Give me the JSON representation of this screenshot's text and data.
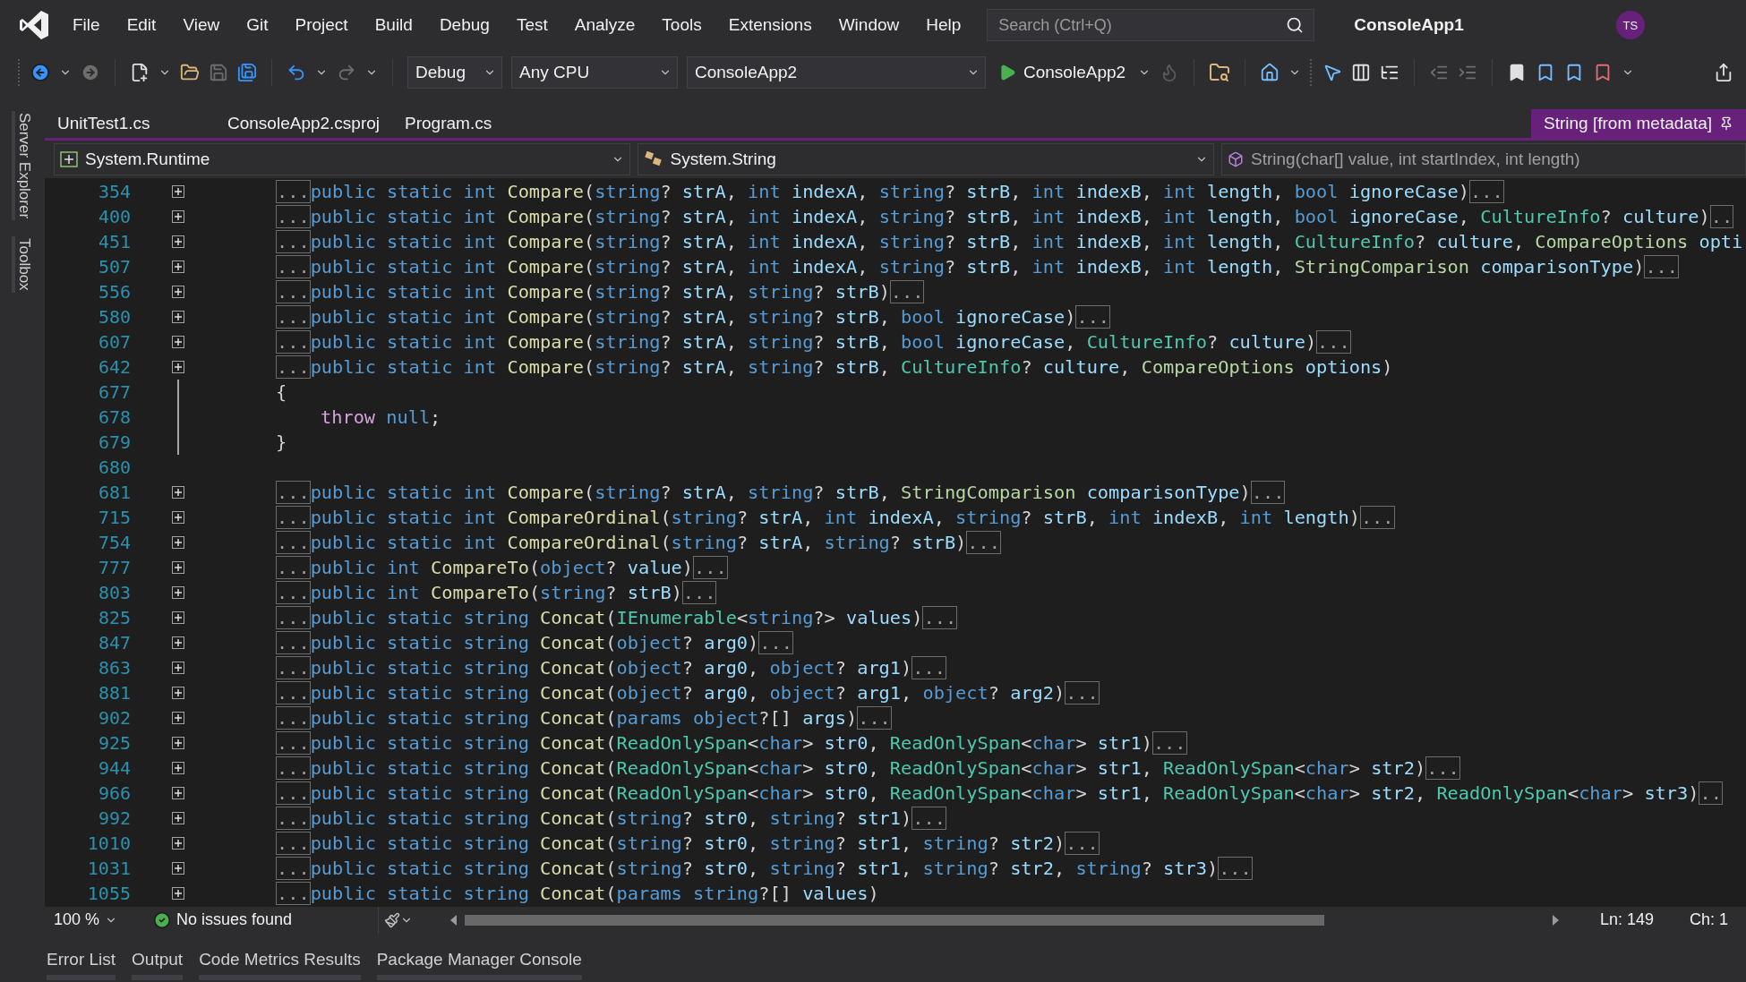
{
  "menu": [
    "File",
    "Edit",
    "View",
    "Git",
    "Project",
    "Build",
    "Debug",
    "Test",
    "Analyze",
    "Tools",
    "Extensions",
    "Window",
    "Help"
  ],
  "search": {
    "placeholder": "Search (Ctrl+Q)"
  },
  "solution_title": "ConsoleApp1",
  "account": {
    "initials": "TS"
  },
  "toolbar": {
    "configuration": "Debug",
    "platform": "Any CPU",
    "startup_project": "ConsoleApp2",
    "run_label": "ConsoleApp2"
  },
  "side_tabs": [
    "Server Explorer",
    "Toolbox"
  ],
  "document_tabs": [
    {
      "label": "UnitTest1.cs",
      "selected": false
    },
    {
      "label": "ConsoleApp2.csproj",
      "selected": false
    },
    {
      "label": "Program.cs",
      "selected": false
    },
    {
      "label": "String [from metadata]",
      "selected": true
    }
  ],
  "navigation": {
    "project": "System.Runtime",
    "type": "System.String",
    "member": "String(char[] value, int startIndex, int length)"
  },
  "code_lines": [
    {
      "number": "354",
      "kind": "collapsed",
      "tokens": [
        {
          "kind": "fold",
          "text": "..."
        },
        {
          "kind": "keyword",
          "text": "public static int "
        },
        {
          "kind": "method",
          "text": "Compare"
        },
        {
          "kind": "punct",
          "text": "("
        },
        {
          "kind": "keyword",
          "text": "string"
        },
        {
          "kind": "punct",
          "text": "? "
        },
        {
          "kind": "param",
          "text": "strA"
        },
        {
          "kind": "punct",
          "text": ", "
        },
        {
          "kind": "keyword",
          "text": "int "
        },
        {
          "kind": "param",
          "text": "indexA"
        },
        {
          "kind": "punct",
          "text": ", "
        },
        {
          "kind": "keyword",
          "text": "string"
        },
        {
          "kind": "punct",
          "text": "? "
        },
        {
          "kind": "param",
          "text": "strB"
        },
        {
          "kind": "punct",
          "text": ", "
        },
        {
          "kind": "keyword",
          "text": "int "
        },
        {
          "kind": "param",
          "text": "indexB"
        },
        {
          "kind": "punct",
          "text": ", "
        },
        {
          "kind": "keyword",
          "text": "int "
        },
        {
          "kind": "param",
          "text": "length"
        },
        {
          "kind": "punct",
          "text": ", "
        },
        {
          "kind": "keyword",
          "text": "bool "
        },
        {
          "kind": "param",
          "text": "ignoreCase"
        },
        {
          "kind": "punct",
          "text": ")"
        },
        {
          "kind": "fold",
          "text": "..."
        }
      ]
    },
    {
      "number": "400",
      "kind": "collapsed",
      "tokens": [
        {
          "kind": "fold",
          "text": "..."
        },
        {
          "kind": "keyword",
          "text": "public static int "
        },
        {
          "kind": "method",
          "text": "Compare"
        },
        {
          "kind": "punct",
          "text": "("
        },
        {
          "kind": "keyword",
          "text": "string"
        },
        {
          "kind": "punct",
          "text": "? "
        },
        {
          "kind": "param",
          "text": "strA"
        },
        {
          "kind": "punct",
          "text": ", "
        },
        {
          "kind": "keyword",
          "text": "int "
        },
        {
          "kind": "param",
          "text": "indexA"
        },
        {
          "kind": "punct",
          "text": ", "
        },
        {
          "kind": "keyword",
          "text": "string"
        },
        {
          "kind": "punct",
          "text": "? "
        },
        {
          "kind": "param",
          "text": "strB"
        },
        {
          "kind": "punct",
          "text": ", "
        },
        {
          "kind": "keyword",
          "text": "int "
        },
        {
          "kind": "param",
          "text": "indexB"
        },
        {
          "kind": "punct",
          "text": ", "
        },
        {
          "kind": "keyword",
          "text": "int "
        },
        {
          "kind": "param",
          "text": "length"
        },
        {
          "kind": "punct",
          "text": ", "
        },
        {
          "kind": "keyword",
          "text": "bool "
        },
        {
          "kind": "param",
          "text": "ignoreCase"
        },
        {
          "kind": "punct",
          "text": ", "
        },
        {
          "kind": "type",
          "text": "CultureInfo"
        },
        {
          "kind": "punct",
          "text": "? "
        },
        {
          "kind": "param",
          "text": "culture"
        },
        {
          "kind": "punct",
          "text": ")"
        },
        {
          "kind": "fold",
          "text": ".."
        }
      ]
    },
    {
      "number": "451",
      "kind": "collapsed",
      "tokens": [
        {
          "kind": "fold",
          "text": "..."
        },
        {
          "kind": "keyword",
          "text": "public static int "
        },
        {
          "kind": "method",
          "text": "Compare"
        },
        {
          "kind": "punct",
          "text": "("
        },
        {
          "kind": "keyword",
          "text": "string"
        },
        {
          "kind": "punct",
          "text": "? "
        },
        {
          "kind": "param",
          "text": "strA"
        },
        {
          "kind": "punct",
          "text": ", "
        },
        {
          "kind": "keyword",
          "text": "int "
        },
        {
          "kind": "param",
          "text": "indexA"
        },
        {
          "kind": "punct",
          "text": ", "
        },
        {
          "kind": "keyword",
          "text": "string"
        },
        {
          "kind": "punct",
          "text": "? "
        },
        {
          "kind": "param",
          "text": "strB"
        },
        {
          "kind": "punct",
          "text": ", "
        },
        {
          "kind": "keyword",
          "text": "int "
        },
        {
          "kind": "param",
          "text": "indexB"
        },
        {
          "kind": "punct",
          "text": ", "
        },
        {
          "kind": "keyword",
          "text": "int "
        },
        {
          "kind": "param",
          "text": "length"
        },
        {
          "kind": "punct",
          "text": ", "
        },
        {
          "kind": "type",
          "text": "CultureInfo"
        },
        {
          "kind": "punct",
          "text": "? "
        },
        {
          "kind": "param",
          "text": "culture"
        },
        {
          "kind": "punct",
          "text": ", "
        },
        {
          "kind": "enum",
          "text": "CompareOptions "
        },
        {
          "kind": "param",
          "text": "opti"
        }
      ]
    },
    {
      "number": "507",
      "kind": "collapsed",
      "tokens": [
        {
          "kind": "fold",
          "text": "..."
        },
        {
          "kind": "keyword",
          "text": "public static int "
        },
        {
          "kind": "method",
          "text": "Compare"
        },
        {
          "kind": "punct",
          "text": "("
        },
        {
          "kind": "keyword",
          "text": "string"
        },
        {
          "kind": "punct",
          "text": "? "
        },
        {
          "kind": "param",
          "text": "strA"
        },
        {
          "kind": "punct",
          "text": ", "
        },
        {
          "kind": "keyword",
          "text": "int "
        },
        {
          "kind": "param",
          "text": "indexA"
        },
        {
          "kind": "punct",
          "text": ", "
        },
        {
          "kind": "keyword",
          "text": "string"
        },
        {
          "kind": "punct",
          "text": "? "
        },
        {
          "kind": "param",
          "text": "strB"
        },
        {
          "kind": "punct",
          "text": ", "
        },
        {
          "kind": "keyword",
          "text": "int "
        },
        {
          "kind": "param",
          "text": "indexB"
        },
        {
          "kind": "punct",
          "text": ", "
        },
        {
          "kind": "keyword",
          "text": "int "
        },
        {
          "kind": "param",
          "text": "length"
        },
        {
          "kind": "punct",
          "text": ", "
        },
        {
          "kind": "enum",
          "text": "StringComparison "
        },
        {
          "kind": "param",
          "text": "comparisonType"
        },
        {
          "kind": "punct",
          "text": ")"
        },
        {
          "kind": "fold",
          "text": "..."
        }
      ]
    },
    {
      "number": "556",
      "kind": "collapsed",
      "tokens": [
        {
          "kind": "fold",
          "text": "..."
        },
        {
          "kind": "keyword",
          "text": "public static int "
        },
        {
          "kind": "method",
          "text": "Compare"
        },
        {
          "kind": "punct",
          "text": "("
        },
        {
          "kind": "keyword",
          "text": "string"
        },
        {
          "kind": "punct",
          "text": "? "
        },
        {
          "kind": "param",
          "text": "strA"
        },
        {
          "kind": "punct",
          "text": ", "
        },
        {
          "kind": "keyword",
          "text": "string"
        },
        {
          "kind": "punct",
          "text": "? "
        },
        {
          "kind": "param",
          "text": "strB"
        },
        {
          "kind": "punct",
          "text": ")"
        },
        {
          "kind": "fold",
          "text": "..."
        }
      ]
    },
    {
      "number": "580",
      "kind": "collapsed",
      "tokens": [
        {
          "kind": "fold",
          "text": "..."
        },
        {
          "kind": "keyword",
          "text": "public static int "
        },
        {
          "kind": "method",
          "text": "Compare"
        },
        {
          "kind": "punct",
          "text": "("
        },
        {
          "kind": "keyword",
          "text": "string"
        },
        {
          "kind": "punct",
          "text": "? "
        },
        {
          "kind": "param",
          "text": "strA"
        },
        {
          "kind": "punct",
          "text": ", "
        },
        {
          "kind": "keyword",
          "text": "string"
        },
        {
          "kind": "punct",
          "text": "? "
        },
        {
          "kind": "param",
          "text": "strB"
        },
        {
          "kind": "punct",
          "text": ", "
        },
        {
          "kind": "keyword",
          "text": "bool "
        },
        {
          "kind": "param",
          "text": "ignoreCase"
        },
        {
          "kind": "punct",
          "text": ")"
        },
        {
          "kind": "fold",
          "text": "..."
        }
      ]
    },
    {
      "number": "607",
      "kind": "collapsed",
      "tokens": [
        {
          "kind": "fold",
          "text": "..."
        },
        {
          "kind": "keyword",
          "text": "public static int "
        },
        {
          "kind": "method",
          "text": "Compare"
        },
        {
          "kind": "punct",
          "text": "("
        },
        {
          "kind": "keyword",
          "text": "string"
        },
        {
          "kind": "punct",
          "text": "? "
        },
        {
          "kind": "param",
          "text": "strA"
        },
        {
          "kind": "punct",
          "text": ", "
        },
        {
          "kind": "keyword",
          "text": "string"
        },
        {
          "kind": "punct",
          "text": "? "
        },
        {
          "kind": "param",
          "text": "strB"
        },
        {
          "kind": "punct",
          "text": ", "
        },
        {
          "kind": "keyword",
          "text": "bool "
        },
        {
          "kind": "param",
          "text": "ignoreCase"
        },
        {
          "kind": "punct",
          "text": ", "
        },
        {
          "kind": "type",
          "text": "CultureInfo"
        },
        {
          "kind": "punct",
          "text": "? "
        },
        {
          "kind": "param",
          "text": "culture"
        },
        {
          "kind": "punct",
          "text": ")"
        },
        {
          "kind": "fold",
          "text": "..."
        }
      ]
    },
    {
      "number": "642",
      "kind": "collapsed",
      "tokens": [
        {
          "kind": "fold",
          "text": "..."
        },
        {
          "kind": "keyword",
          "text": "public static int "
        },
        {
          "kind": "method",
          "text": "Compare"
        },
        {
          "kind": "punct",
          "text": "("
        },
        {
          "kind": "keyword",
          "text": "string"
        },
        {
          "kind": "punct",
          "text": "? "
        },
        {
          "kind": "param",
          "text": "strA"
        },
        {
          "kind": "punct",
          "text": ", "
        },
        {
          "kind": "keyword",
          "text": "string"
        },
        {
          "kind": "punct",
          "text": "? "
        },
        {
          "kind": "param",
          "text": "strB"
        },
        {
          "kind": "punct",
          "text": ", "
        },
        {
          "kind": "type",
          "text": "CultureInfo"
        },
        {
          "kind": "punct",
          "text": "? "
        },
        {
          "kind": "param",
          "text": "culture"
        },
        {
          "kind": "punct",
          "text": ", "
        },
        {
          "kind": "enum",
          "text": "CompareOptions "
        },
        {
          "kind": "param",
          "text": "options"
        },
        {
          "kind": "punct",
          "text": ")"
        }
      ]
    },
    {
      "number": "677",
      "kind": "block",
      "tokens": [
        {
          "kind": "punct",
          "text": "{"
        }
      ]
    },
    {
      "number": "678",
      "kind": "body",
      "tokens": [
        {
          "kind": "control",
          "text": "throw "
        },
        {
          "kind": "keyword",
          "text": "null"
        },
        {
          "kind": "punct",
          "text": ";"
        }
      ]
    },
    {
      "number": "679",
      "kind": "block",
      "tokens": [
        {
          "kind": "punct",
          "text": "}"
        }
      ]
    },
    {
      "number": "680",
      "kind": "blank"
    },
    {
      "number": "681",
      "kind": "collapsed",
      "tokens": [
        {
          "kind": "fold",
          "text": "..."
        },
        {
          "kind": "keyword",
          "text": "public static int "
        },
        {
          "kind": "method",
          "text": "Compare"
        },
        {
          "kind": "punct",
          "text": "("
        },
        {
          "kind": "keyword",
          "text": "string"
        },
        {
          "kind": "punct",
          "text": "? "
        },
        {
          "kind": "param",
          "text": "strA"
        },
        {
          "kind": "punct",
          "text": ", "
        },
        {
          "kind": "keyword",
          "text": "string"
        },
        {
          "kind": "punct",
          "text": "? "
        },
        {
          "kind": "param",
          "text": "strB"
        },
        {
          "kind": "punct",
          "text": ", "
        },
        {
          "kind": "enum",
          "text": "StringComparison "
        },
        {
          "kind": "param",
          "text": "comparisonType"
        },
        {
          "kind": "punct",
          "text": ")"
        },
        {
          "kind": "fold",
          "text": "..."
        }
      ]
    },
    {
      "number": "715",
      "kind": "collapsed",
      "tokens": [
        {
          "kind": "fold",
          "text": "..."
        },
        {
          "kind": "keyword",
          "text": "public static int "
        },
        {
          "kind": "method",
          "text": "CompareOrdinal"
        },
        {
          "kind": "punct",
          "text": "("
        },
        {
          "kind": "keyword",
          "text": "string"
        },
        {
          "kind": "punct",
          "text": "? "
        },
        {
          "kind": "param",
          "text": "strA"
        },
        {
          "kind": "punct",
          "text": ", "
        },
        {
          "kind": "keyword",
          "text": "int "
        },
        {
          "kind": "param",
          "text": "indexA"
        },
        {
          "kind": "punct",
          "text": ", "
        },
        {
          "kind": "keyword",
          "text": "string"
        },
        {
          "kind": "punct",
          "text": "? "
        },
        {
          "kind": "param",
          "text": "strB"
        },
        {
          "kind": "punct",
          "text": ", "
        },
        {
          "kind": "keyword",
          "text": "int "
        },
        {
          "kind": "param",
          "text": "indexB"
        },
        {
          "kind": "punct",
          "text": ", "
        },
        {
          "kind": "keyword",
          "text": "int "
        },
        {
          "kind": "param",
          "text": "length"
        },
        {
          "kind": "punct",
          "text": ")"
        },
        {
          "kind": "fold",
          "text": "..."
        }
      ]
    },
    {
      "number": "754",
      "kind": "collapsed",
      "tokens": [
        {
          "kind": "fold",
          "text": "..."
        },
        {
          "kind": "keyword",
          "text": "public static int "
        },
        {
          "kind": "method",
          "text": "CompareOrdinal"
        },
        {
          "kind": "punct",
          "text": "("
        },
        {
          "kind": "keyword",
          "text": "string"
        },
        {
          "kind": "punct",
          "text": "? "
        },
        {
          "kind": "param",
          "text": "strA"
        },
        {
          "kind": "punct",
          "text": ", "
        },
        {
          "kind": "keyword",
          "text": "string"
        },
        {
          "kind": "punct",
          "text": "? "
        },
        {
          "kind": "param",
          "text": "strB"
        },
        {
          "kind": "punct",
          "text": ")"
        },
        {
          "kind": "fold",
          "text": "..."
        }
      ]
    },
    {
      "number": "777",
      "kind": "collapsed",
      "tokens": [
        {
          "kind": "fold",
          "text": "..."
        },
        {
          "kind": "keyword",
          "text": "public int "
        },
        {
          "kind": "method",
          "text": "CompareTo"
        },
        {
          "kind": "punct",
          "text": "("
        },
        {
          "kind": "keyword",
          "text": "object"
        },
        {
          "kind": "punct",
          "text": "? "
        },
        {
          "kind": "param",
          "text": "value"
        },
        {
          "kind": "punct",
          "text": ")"
        },
        {
          "kind": "fold",
          "text": "..."
        }
      ]
    },
    {
      "number": "803",
      "kind": "collapsed",
      "tokens": [
        {
          "kind": "fold",
          "text": "..."
        },
        {
          "kind": "keyword",
          "text": "public int "
        },
        {
          "kind": "method",
          "text": "CompareTo"
        },
        {
          "kind": "punct",
          "text": "("
        },
        {
          "kind": "keyword",
          "text": "string"
        },
        {
          "kind": "punct",
          "text": "? "
        },
        {
          "kind": "param",
          "text": "strB"
        },
        {
          "kind": "punct",
          "text": ")"
        },
        {
          "kind": "fold",
          "text": "..."
        }
      ]
    },
    {
      "number": "825",
      "kind": "collapsed",
      "tokens": [
        {
          "kind": "fold",
          "text": "..."
        },
        {
          "kind": "keyword",
          "text": "public static string "
        },
        {
          "kind": "method",
          "text": "Concat"
        },
        {
          "kind": "punct",
          "text": "("
        },
        {
          "kind": "type",
          "text": "IEnumerable"
        },
        {
          "kind": "punct",
          "text": "<"
        },
        {
          "kind": "keyword",
          "text": "string"
        },
        {
          "kind": "punct",
          "text": "?> "
        },
        {
          "kind": "param",
          "text": "values"
        },
        {
          "kind": "punct",
          "text": ")"
        },
        {
          "kind": "fold",
          "text": "..."
        }
      ]
    },
    {
      "number": "847",
      "kind": "collapsed",
      "tokens": [
        {
          "kind": "fold",
          "text": "..."
        },
        {
          "kind": "keyword",
          "text": "public static string "
        },
        {
          "kind": "method",
          "text": "Concat"
        },
        {
          "kind": "punct",
          "text": "("
        },
        {
          "kind": "keyword",
          "text": "object"
        },
        {
          "kind": "punct",
          "text": "? "
        },
        {
          "kind": "param",
          "text": "arg0"
        },
        {
          "kind": "punct",
          "text": ")"
        },
        {
          "kind": "fold",
          "text": "..."
        }
      ]
    },
    {
      "number": "863",
      "kind": "collapsed",
      "tokens": [
        {
          "kind": "fold",
          "text": "..."
        },
        {
          "kind": "keyword",
          "text": "public static string "
        },
        {
          "kind": "method",
          "text": "Concat"
        },
        {
          "kind": "punct",
          "text": "("
        },
        {
          "kind": "keyword",
          "text": "object"
        },
        {
          "kind": "punct",
          "text": "? "
        },
        {
          "kind": "param",
          "text": "arg0"
        },
        {
          "kind": "punct",
          "text": ", "
        },
        {
          "kind": "keyword",
          "text": "object"
        },
        {
          "kind": "punct",
          "text": "? "
        },
        {
          "kind": "param",
          "text": "arg1"
        },
        {
          "kind": "punct",
          "text": ")"
        },
        {
          "kind": "fold",
          "text": "..."
        }
      ]
    },
    {
      "number": "881",
      "kind": "collapsed",
      "tokens": [
        {
          "kind": "fold",
          "text": "..."
        },
        {
          "kind": "keyword",
          "text": "public static string "
        },
        {
          "kind": "method",
          "text": "Concat"
        },
        {
          "kind": "punct",
          "text": "("
        },
        {
          "kind": "keyword",
          "text": "object"
        },
        {
          "kind": "punct",
          "text": "? "
        },
        {
          "kind": "param",
          "text": "arg0"
        },
        {
          "kind": "punct",
          "text": ", "
        },
        {
          "kind": "keyword",
          "text": "object"
        },
        {
          "kind": "punct",
          "text": "? "
        },
        {
          "kind": "param",
          "text": "arg1"
        },
        {
          "kind": "punct",
          "text": ", "
        },
        {
          "kind": "keyword",
          "text": "object"
        },
        {
          "kind": "punct",
          "text": "? "
        },
        {
          "kind": "param",
          "text": "arg2"
        },
        {
          "kind": "punct",
          "text": ")"
        },
        {
          "kind": "fold",
          "text": "..."
        }
      ]
    },
    {
      "number": "902",
      "kind": "collapsed",
      "tokens": [
        {
          "kind": "fold",
          "text": "..."
        },
        {
          "kind": "keyword",
          "text": "public static string "
        },
        {
          "kind": "method",
          "text": "Concat"
        },
        {
          "kind": "punct",
          "text": "("
        },
        {
          "kind": "keyword",
          "text": "params object"
        },
        {
          "kind": "punct",
          "text": "?[] "
        },
        {
          "kind": "param",
          "text": "args"
        },
        {
          "kind": "punct",
          "text": ")"
        },
        {
          "kind": "fold",
          "text": "..."
        }
      ]
    },
    {
      "number": "925",
      "kind": "collapsed",
      "tokens": [
        {
          "kind": "fold",
          "text": "..."
        },
        {
          "kind": "keyword",
          "text": "public static string "
        },
        {
          "kind": "method",
          "text": "Concat"
        },
        {
          "kind": "punct",
          "text": "("
        },
        {
          "kind": "type",
          "text": "ReadOnlySpan"
        },
        {
          "kind": "punct",
          "text": "<"
        },
        {
          "kind": "keyword",
          "text": "char"
        },
        {
          "kind": "punct",
          "text": "> "
        },
        {
          "kind": "param",
          "text": "str0"
        },
        {
          "kind": "punct",
          "text": ", "
        },
        {
          "kind": "type",
          "text": "ReadOnlySpan"
        },
        {
          "kind": "punct",
          "text": "<"
        },
        {
          "kind": "keyword",
          "text": "char"
        },
        {
          "kind": "punct",
          "text": "> "
        },
        {
          "kind": "param",
          "text": "str1"
        },
        {
          "kind": "punct",
          "text": ")"
        },
        {
          "kind": "fold",
          "text": "..."
        }
      ]
    },
    {
      "number": "944",
      "kind": "collapsed",
      "tokens": [
        {
          "kind": "fold",
          "text": "..."
        },
        {
          "kind": "keyword",
          "text": "public static string "
        },
        {
          "kind": "method",
          "text": "Concat"
        },
        {
          "kind": "punct",
          "text": "("
        },
        {
          "kind": "type",
          "text": "ReadOnlySpan"
        },
        {
          "kind": "punct",
          "text": "<"
        },
        {
          "kind": "keyword",
          "text": "char"
        },
        {
          "kind": "punct",
          "text": "> "
        },
        {
          "kind": "param",
          "text": "str0"
        },
        {
          "kind": "punct",
          "text": ", "
        },
        {
          "kind": "type",
          "text": "ReadOnlySpan"
        },
        {
          "kind": "punct",
          "text": "<"
        },
        {
          "kind": "keyword",
          "text": "char"
        },
        {
          "kind": "punct",
          "text": "> "
        },
        {
          "kind": "param",
          "text": "str1"
        },
        {
          "kind": "punct",
          "text": ", "
        },
        {
          "kind": "type",
          "text": "ReadOnlySpan"
        },
        {
          "kind": "punct",
          "text": "<"
        },
        {
          "kind": "keyword",
          "text": "char"
        },
        {
          "kind": "punct",
          "text": "> "
        },
        {
          "kind": "param",
          "text": "str2"
        },
        {
          "kind": "punct",
          "text": ")"
        },
        {
          "kind": "fold",
          "text": "..."
        }
      ]
    },
    {
      "number": "966",
      "kind": "collapsed",
      "tokens": [
        {
          "kind": "fold",
          "text": "..."
        },
        {
          "kind": "keyword",
          "text": "public static string "
        },
        {
          "kind": "method",
          "text": "Concat"
        },
        {
          "kind": "punct",
          "text": "("
        },
        {
          "kind": "type",
          "text": "ReadOnlySpan"
        },
        {
          "kind": "punct",
          "text": "<"
        },
        {
          "kind": "keyword",
          "text": "char"
        },
        {
          "kind": "punct",
          "text": "> "
        },
        {
          "kind": "param",
          "text": "str0"
        },
        {
          "kind": "punct",
          "text": ", "
        },
        {
          "kind": "type",
          "text": "ReadOnlySpan"
        },
        {
          "kind": "punct",
          "text": "<"
        },
        {
          "kind": "keyword",
          "text": "char"
        },
        {
          "kind": "punct",
          "text": "> "
        },
        {
          "kind": "param",
          "text": "str1"
        },
        {
          "kind": "punct",
          "text": ", "
        },
        {
          "kind": "type",
          "text": "ReadOnlySpan"
        },
        {
          "kind": "punct",
          "text": "<"
        },
        {
          "kind": "keyword",
          "text": "char"
        },
        {
          "kind": "punct",
          "text": "> "
        },
        {
          "kind": "param",
          "text": "str2"
        },
        {
          "kind": "punct",
          "text": ", "
        },
        {
          "kind": "type",
          "text": "ReadOnlySpan"
        },
        {
          "kind": "punct",
          "text": "<"
        },
        {
          "kind": "keyword",
          "text": "char"
        },
        {
          "kind": "punct",
          "text": "> "
        },
        {
          "kind": "param",
          "text": "str3"
        },
        {
          "kind": "punct",
          "text": ")"
        },
        {
          "kind": "fold",
          "text": ".."
        }
      ]
    },
    {
      "number": "992",
      "kind": "collapsed",
      "tokens": [
        {
          "kind": "fold",
          "text": "..."
        },
        {
          "kind": "keyword",
          "text": "public static string "
        },
        {
          "kind": "method",
          "text": "Concat"
        },
        {
          "kind": "punct",
          "text": "("
        },
        {
          "kind": "keyword",
          "text": "string"
        },
        {
          "kind": "punct",
          "text": "? "
        },
        {
          "kind": "param",
          "text": "str0"
        },
        {
          "kind": "punct",
          "text": ", "
        },
        {
          "kind": "keyword",
          "text": "string"
        },
        {
          "kind": "punct",
          "text": "? "
        },
        {
          "kind": "param",
          "text": "str1"
        },
        {
          "kind": "punct",
          "text": ")"
        },
        {
          "kind": "fold",
          "text": "..."
        }
      ]
    },
    {
      "number": "1010",
      "kind": "collapsed",
      "tokens": [
        {
          "kind": "fold",
          "text": "..."
        },
        {
          "kind": "keyword",
          "text": "public static string "
        },
        {
          "kind": "method",
          "text": "Concat"
        },
        {
          "kind": "punct",
          "text": "("
        },
        {
          "kind": "keyword",
          "text": "string"
        },
        {
          "kind": "punct",
          "text": "? "
        },
        {
          "kind": "param",
          "text": "str0"
        },
        {
          "kind": "punct",
          "text": ", "
        },
        {
          "kind": "keyword",
          "text": "string"
        },
        {
          "kind": "punct",
          "text": "? "
        },
        {
          "kind": "param",
          "text": "str1"
        },
        {
          "kind": "punct",
          "text": ", "
        },
        {
          "kind": "keyword",
          "text": "string"
        },
        {
          "kind": "punct",
          "text": "? "
        },
        {
          "kind": "param",
          "text": "str2"
        },
        {
          "kind": "punct",
          "text": ")"
        },
        {
          "kind": "fold",
          "text": "..."
        }
      ]
    },
    {
      "number": "1031",
      "kind": "collapsed",
      "tokens": [
        {
          "kind": "fold",
          "text": "..."
        },
        {
          "kind": "keyword",
          "text": "public static string "
        },
        {
          "kind": "method",
          "text": "Concat"
        },
        {
          "kind": "punct",
          "text": "("
        },
        {
          "kind": "keyword",
          "text": "string"
        },
        {
          "kind": "punct",
          "text": "? "
        },
        {
          "kind": "param",
          "text": "str0"
        },
        {
          "kind": "punct",
          "text": ", "
        },
        {
          "kind": "keyword",
          "text": "string"
        },
        {
          "kind": "punct",
          "text": "? "
        },
        {
          "kind": "param",
          "text": "str1"
        },
        {
          "kind": "punct",
          "text": ", "
        },
        {
          "kind": "keyword",
          "text": "string"
        },
        {
          "kind": "punct",
          "text": "? "
        },
        {
          "kind": "param",
          "text": "str2"
        },
        {
          "kind": "punct",
          "text": ", "
        },
        {
          "kind": "keyword",
          "text": "string"
        },
        {
          "kind": "punct",
          "text": "? "
        },
        {
          "kind": "param",
          "text": "str3"
        },
        {
          "kind": "punct",
          "text": ")"
        },
        {
          "kind": "fold",
          "text": "..."
        }
      ]
    },
    {
      "number": "1055",
      "kind": "collapsed",
      "tokens": [
        {
          "kind": "fold",
          "text": "..."
        },
        {
          "kind": "keyword",
          "text": "public static string "
        },
        {
          "kind": "method",
          "text": "Concat"
        },
        {
          "kind": "punct",
          "text": "("
        },
        {
          "kind": "keyword",
          "text": "params string"
        },
        {
          "kind": "punct",
          "text": "?[] "
        },
        {
          "kind": "param",
          "text": "values"
        },
        {
          "kind": "punct",
          "text": ")"
        }
      ]
    }
  ],
  "status": {
    "zoom": "100 %",
    "issues": "No issues found",
    "line": "Ln: 149",
    "column": "Ch: 1"
  },
  "tool_tabs": [
    "Error List",
    "Output",
    "Code Metrics Results",
    "Package Manager Console"
  ]
}
